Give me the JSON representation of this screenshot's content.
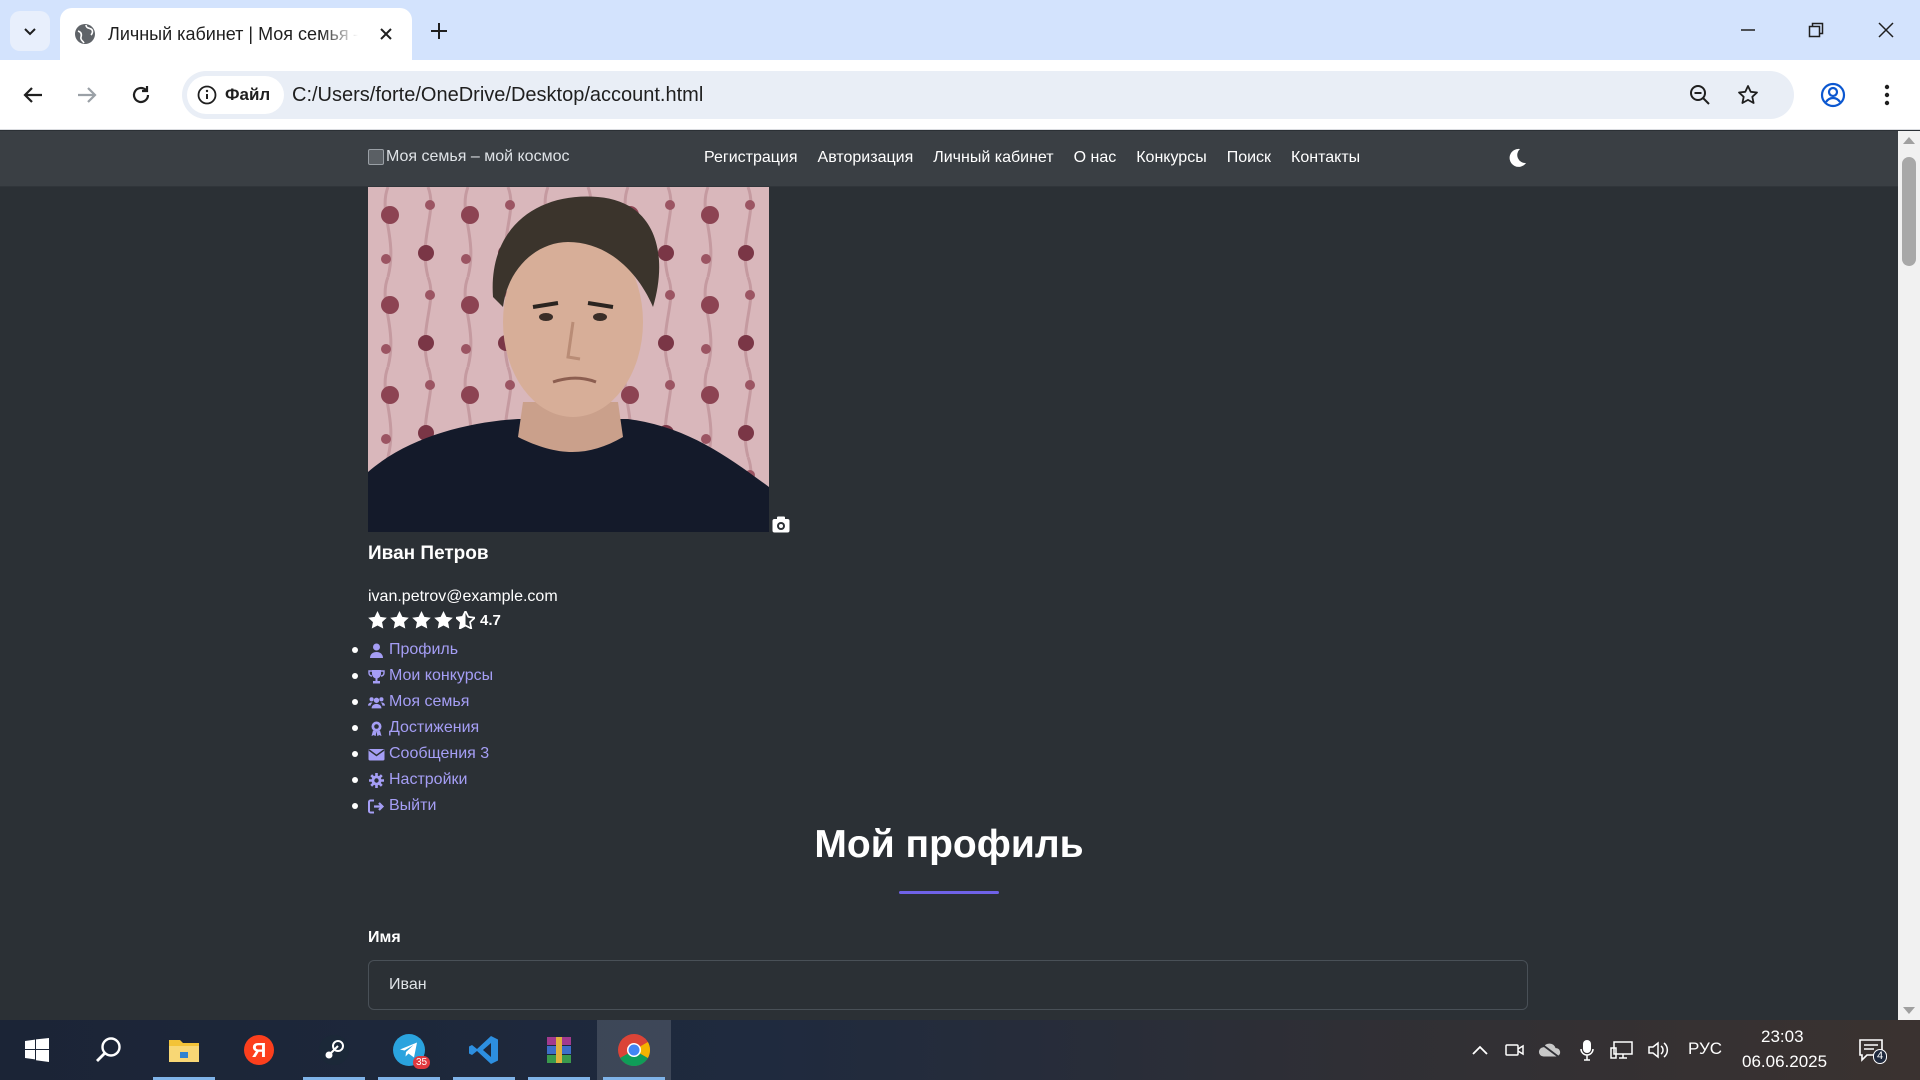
{
  "browser": {
    "tab_title": "Личный кабинет | Моя семья – мой космос",
    "security_chip_label": "Файл",
    "url": "C:/Users/forte/OneDrive/Desktop/account.html"
  },
  "site": {
    "brand_alt": "Моя семья – мой космос",
    "nav": [
      "Регистрация",
      "Авторизация",
      "Личный кабинет",
      "О нас",
      "Конкурсы",
      "Поиск",
      "Контакты"
    ]
  },
  "profile": {
    "name": "Иван Петров",
    "email": "ivan.petrov@example.com",
    "rating": 4.5,
    "rating_label": "4.7"
  },
  "menu": [
    {
      "icon": "user-icon",
      "label": "Профиль"
    },
    {
      "icon": "trophy-icon",
      "label": "Мои конкурсы"
    },
    {
      "icon": "users-icon",
      "label": "Моя семья"
    },
    {
      "icon": "award-icon",
      "label": "Достижения"
    },
    {
      "icon": "envelope-icon",
      "label": "Сообщения 3"
    },
    {
      "icon": "cog-icon",
      "label": "Настройки"
    },
    {
      "icon": "sign-out-icon",
      "label": "Выйти"
    }
  ],
  "main": {
    "section_title": "Мой профиль",
    "first_name_label": "Имя",
    "first_name_value": "Иван"
  },
  "taskbar": {
    "telegram_badge": "35",
    "language": "РУС",
    "time": "23:03",
    "date": "06.06.2025",
    "notifications_count": "4"
  },
  "colors": {
    "page_bg": "#2b3035",
    "navbar_bg": "#3a3f44",
    "accent": "#6f62e8",
    "link": "#a59ef5"
  }
}
